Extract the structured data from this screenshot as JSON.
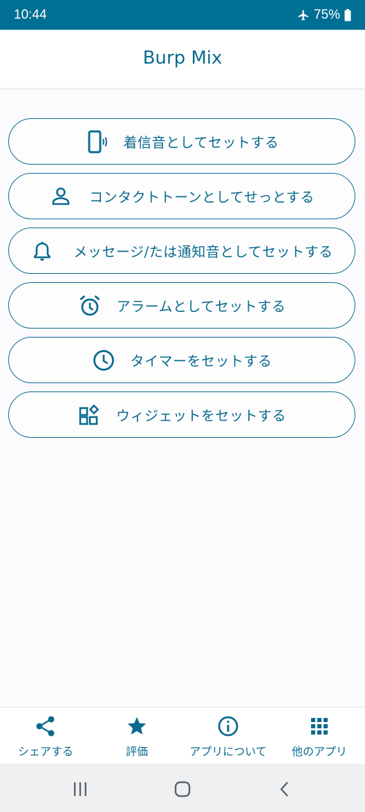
{
  "status_bar": {
    "time": "10:44",
    "battery": "75%",
    "icons": [
      "airplane-mode-icon",
      "battery-icon"
    ]
  },
  "header": {
    "title": "Burp Mix"
  },
  "actions": [
    {
      "label": "着信音としてセットする",
      "icon": "phone-ringtone-icon"
    },
    {
      "label": "コンタクトトーンとしてせっとする",
      "icon": "contact-person-icon"
    },
    {
      "label": "メッセージ/たは通知音としてセットする",
      "icon": "bell-icon"
    },
    {
      "label": "アラームとしてセットする",
      "icon": "alarm-clock-icon"
    },
    {
      "label": "タイマーをセットする",
      "icon": "clock-icon"
    },
    {
      "label": "ウィジェットをセットする",
      "icon": "widgets-icon"
    }
  ],
  "bottom_nav": [
    {
      "label": "シェアする",
      "icon": "share-icon"
    },
    {
      "label": "評価",
      "icon": "star-icon"
    },
    {
      "label": "アプリについて",
      "icon": "info-icon"
    },
    {
      "label": "他のアプリ",
      "icon": "apps-grid-icon"
    }
  ],
  "system_nav": [
    "recent-apps-icon",
    "home-icon",
    "back-icon"
  ],
  "colors": {
    "accent": "#0a6a8e",
    "status_bar": "#006f94",
    "background": "#fbfbfd"
  }
}
